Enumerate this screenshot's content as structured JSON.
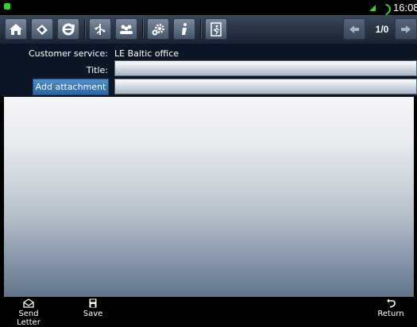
{
  "status_bar": {
    "time": "16:08"
  },
  "toolbar": {
    "buttons": [
      {
        "name": "home-icon"
      },
      {
        "name": "gem-icon"
      },
      {
        "name": "browser-icon"
      },
      {
        "name": "tree-icon"
      },
      {
        "name": "contacts-icon"
      },
      {
        "name": "settings-icon"
      },
      {
        "name": "info-icon"
      },
      {
        "name": "exit-icon"
      }
    ],
    "page_indicator": "1/0"
  },
  "form": {
    "customer_service_label": "Customer service:",
    "customer_service_value": "LE Baltic office",
    "title_label": "Title:",
    "title_value": "",
    "add_attachment_label": "Add attachment",
    "attachment_value": ""
  },
  "message": {
    "body": ""
  },
  "bottom_bar": {
    "send_letter": "Send Letter",
    "save": "Save",
    "return": "Return"
  },
  "colors": {
    "toolbar_top": "#39475a",
    "toolbar_bottom": "#1a2332",
    "form_background": "#0c1726",
    "attach_button": "#3a78b8",
    "status_icon": "#3ad12a"
  }
}
